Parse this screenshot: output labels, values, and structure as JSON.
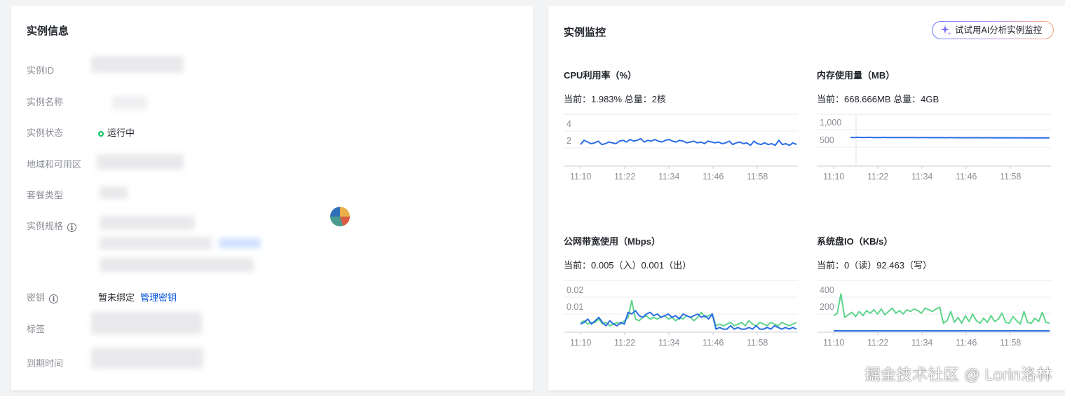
{
  "info": {
    "title": "实例信息",
    "rows": {
      "id": {
        "label": "实例ID"
      },
      "name": {
        "label": "实例名称"
      },
      "status": {
        "label": "实例状态",
        "value": "运行中"
      },
      "region": {
        "label": "地域和可用区"
      },
      "package": {
        "label": "套餐类型"
      },
      "spec": {
        "label": "实例规格"
      },
      "key": {
        "label": "密钥",
        "value": "暂未绑定",
        "link": "管理密钥"
      },
      "tags": {
        "label": "标签"
      },
      "expire": {
        "label": "到期时间"
      }
    },
    "colors": {
      "status": "#0abf5b",
      "link": "#0052d9"
    }
  },
  "monitor": {
    "title": "实例监控",
    "ai_button": "试试用AI分析实例监控",
    "line_colors": {
      "primary": "#2b6de5",
      "secondary": "#5fd48c"
    }
  },
  "watermark": "掘金技术社区 @ Lorin洛林",
  "chart_data": [
    {
      "type": "line",
      "title": "CPU利用率（%）",
      "subtitle": "当前：1.983% 总量：2核",
      "x_ticks": [
        "11:10",
        "11:22",
        "11:34",
        "11:46",
        "11:58"
      ],
      "y_ticks": [
        2,
        4
      ],
      "ylim": [
        0,
        5
      ],
      "series": [
        {
          "values": [
            2.4,
            2.9,
            2.7,
            2.5,
            2.6,
            2.8,
            2.4,
            2.5,
            2.7,
            2.6,
            2.5,
            2.8,
            2.9,
            2.7,
            3.0,
            2.8,
            2.9,
            3.1,
            2.7,
            2.9,
            2.8,
            3.0,
            2.8,
            2.7,
            2.9,
            3.0,
            2.8,
            2.7,
            2.9,
            2.8,
            2.6,
            2.7,
            2.8,
            2.6,
            2.7,
            2.5,
            2.8,
            2.7,
            2.6,
            2.7,
            2.5,
            2.6,
            2.8,
            2.4,
            2.6,
            2.7,
            2.5,
            2.6,
            2.3,
            2.8,
            2.5,
            2.4,
            2.6,
            2.4,
            2.5,
            2.3,
            2.9,
            2.4,
            2.5,
            2.3,
            2.6,
            2.4
          ]
        }
      ]
    },
    {
      "type": "line",
      "title": "内存使用量（MB）",
      "subtitle": "当前：668.666MB 总量：4GB",
      "x_ticks": [
        "11:10",
        "11:22",
        "11:34",
        "11:46",
        "11:58"
      ],
      "y_ticks": [
        500,
        1000
      ],
      "y_tick_labels": [
        "500",
        "1,000"
      ],
      "ylim": [
        0,
        1200
      ],
      "series": [
        {
          "values": [
            780,
            775,
            782,
            778,
            776,
            780,
            779,
            777,
            778,
            776,
            779,
            775,
            777,
            778,
            776,
            774,
            777,
            775,
            776,
            774,
            773,
            775,
            774,
            772,
            774,
            773,
            772,
            774,
            771,
            773,
            772,
            770,
            772,
            771,
            770,
            772,
            769,
            771,
            770,
            768,
            770,
            769,
            768,
            770,
            767,
            769,
            768,
            767,
            769,
            766,
            768,
            767,
            766,
            768,
            765,
            767,
            766,
            768,
            765,
            767
          ]
        }
      ]
    },
    {
      "type": "line",
      "title": "公网带宽使用（Mbps）",
      "subtitle": "当前：0.005（入）0.001（出）",
      "x_ticks": [
        "11:10",
        "11:22",
        "11:34",
        "11:46",
        "11:58"
      ],
      "y_ticks": [
        0.01,
        0.02
      ],
      "ylim": [
        0,
        0.025
      ],
      "series": [
        {
          "values": [
            0.004,
            0.005,
            0.007,
            0.004,
            0.006,
            0.008,
            0.005,
            0.003,
            0.006,
            0.004,
            0.003,
            0.005,
            0.004,
            0.011,
            0.01,
            0.012,
            0.009,
            0.008,
            0.01,
            0.011,
            0.009,
            0.01,
            0.008,
            0.009,
            0.01,
            0.008,
            0.009,
            0.007,
            0.01,
            0.009,
            0.008,
            0.009,
            0.01,
            0.008,
            0.009,
            0.007,
            0.01,
            0.001,
            0.002,
            0.001,
            0.001,
            0.003,
            0.001,
            0.002,
            0.001,
            0.001,
            0.002,
            0.001,
            0.003,
            0.001,
            0.001,
            0.002,
            0.001,
            0.003,
            0.002,
            0.001,
            0.002,
            0.001,
            0.002,
            0.001
          ]
        },
        {
          "values": [
            0.005,
            0.006,
            0.004,
            0.005,
            0.005,
            0.007,
            0.004,
            0.005,
            0.003,
            0.004,
            0.005,
            0.004,
            0.006,
            0.008,
            0.018,
            0.007,
            0.006,
            0.008,
            0.009,
            0.007,
            0.008,
            0.007,
            0.008,
            0.009,
            0.007,
            0.008,
            0.006,
            0.008,
            0.007,
            0.009,
            0.008,
            0.006,
            0.008,
            0.011,
            0.008,
            0.009,
            0.01,
            0.003,
            0.004,
            0.003,
            0.004,
            0.005,
            0.003,
            0.004,
            0.005,
            0.003,
            0.006,
            0.004,
            0.003,
            0.005,
            0.004,
            0.003,
            0.005,
            0.004,
            0.003,
            0.005,
            0.004,
            0.003,
            0.004,
            0.005
          ]
        }
      ]
    },
    {
      "type": "line",
      "title": "系统盘IO（KB/s）",
      "subtitle": "当前：0（读）92.463（写）",
      "x_ticks": [
        "11:10",
        "11:22",
        "11:34",
        "11:46",
        "11:58"
      ],
      "y_ticks": [
        200,
        400
      ],
      "ylim": [
        0,
        500
      ],
      "series": [
        {
          "values": [
            0,
            0,
            0,
            0,
            0,
            0,
            0,
            0,
            0,
            0,
            0,
            0,
            0,
            0,
            0,
            0,
            0,
            0,
            0,
            0,
            0,
            0,
            0,
            0,
            0,
            0,
            0,
            0,
            0,
            0,
            0,
            0,
            0,
            0,
            0,
            0,
            0,
            0,
            0,
            0,
            0,
            0,
            0,
            0,
            0,
            0,
            0,
            0,
            0,
            0,
            0,
            0,
            0,
            0,
            0,
            0,
            0,
            0,
            0,
            0
          ]
        },
        {
          "values": [
            180,
            210,
            440,
            160,
            190,
            220,
            170,
            230,
            180,
            240,
            210,
            250,
            200,
            260,
            190,
            230,
            270,
            210,
            240,
            200,
            250,
            230,
            260,
            240,
            210,
            270,
            250,
            230,
            260,
            280,
            90,
            120,
            230,
            100,
            160,
            90,
            180,
            110,
            200,
            120,
            90,
            150,
            100,
            180,
            110,
            140,
            210,
            100,
            90,
            170,
            120,
            80,
            230,
            100,
            90,
            150,
            110,
            220,
            100,
            92
          ]
        }
      ]
    }
  ]
}
